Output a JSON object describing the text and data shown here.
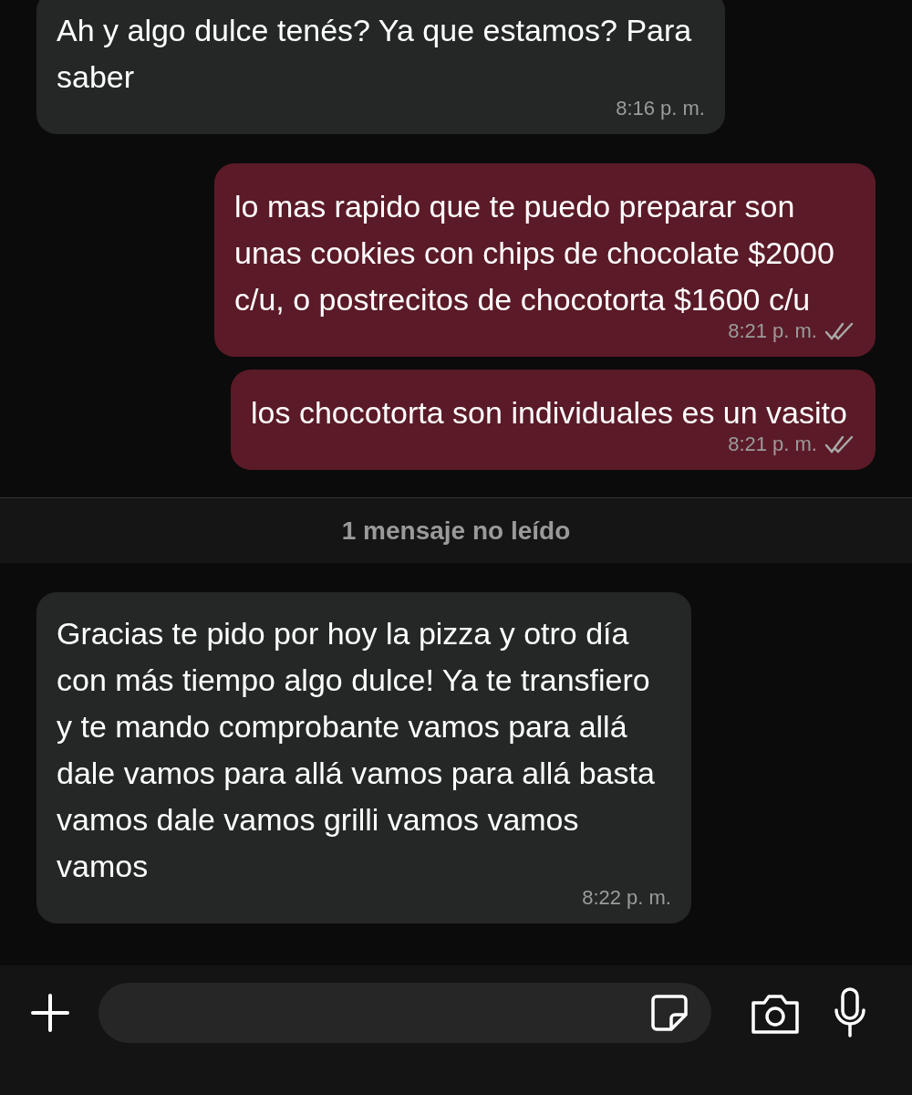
{
  "messages": [
    {
      "kind": "incoming",
      "text": "Ah y algo dulce tenés? Ya que estamos? Para saber",
      "time": "8:16 p. m."
    },
    {
      "kind": "outgoing",
      "text": "lo mas rapido que te puedo preparar son unas cookies con chips de chocolate $2000 c/u, o postrecitos de chocotorta $1600 c/u",
      "time": "8:21 p. m.",
      "read": false
    },
    {
      "kind": "outgoing",
      "text": "los chocotorta son individuales es un vasito",
      "time": "8:21 p. m.",
      "read": false
    },
    {
      "kind": "divider",
      "text": "1 mensaje no leído"
    },
    {
      "kind": "incoming",
      "text": "Gracias te pido por hoy la pizza y otro día con más tiempo algo dulce! Ya te transfiero y te mando comprobante vamos para allá dale vamos para allá vamos para allá basta vamos dale vamos grilli vamos vamos vamos",
      "time": "8:22 p. m."
    }
  ]
}
